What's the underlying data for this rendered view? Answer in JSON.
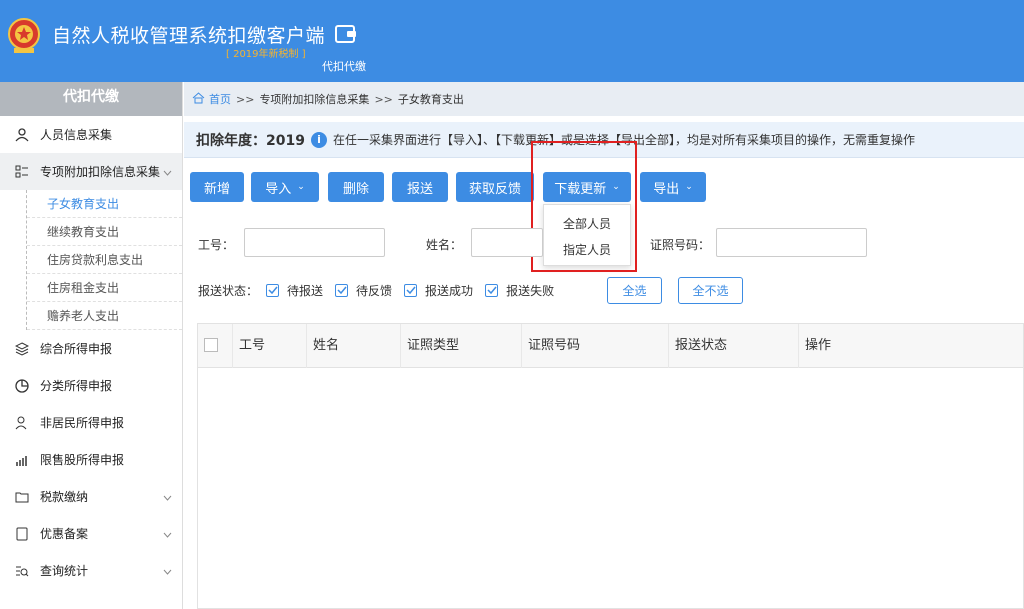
{
  "header": {
    "app_title": "自然人税收管理系统扣缴客户端",
    "version": "[ 2019年新税制 ]",
    "module_label": "代扣代缴"
  },
  "sidebar": {
    "title": "代扣代缴",
    "items": [
      {
        "label": "人员信息采集",
        "icon": "person-icon"
      },
      {
        "label": "专项附加扣除信息采集",
        "icon": "list-icon",
        "expanded": true,
        "children": [
          "子女教育支出",
          "继续教育支出",
          "住房贷款利息支出",
          "住房租金支出",
          "赡养老人支出"
        ]
      },
      {
        "label": "综合所得申报",
        "icon": "layers-icon"
      },
      {
        "label": "分类所得申报",
        "icon": "pie-icon"
      },
      {
        "label": "非居民所得申报",
        "icon": "user-outline-icon"
      },
      {
        "label": "限售股所得申报",
        "icon": "chart-icon"
      },
      {
        "label": "税款缴纳",
        "icon": "folder-icon"
      },
      {
        "label": "优惠备案",
        "icon": "document-icon"
      },
      {
        "label": "查询统计",
        "icon": "search-list-icon"
      }
    ]
  },
  "breadcrumb": {
    "home": "首页",
    "sep": ">>",
    "level1": "专项附加扣除信息采集",
    "level2": "子女教育支出"
  },
  "info_bar": {
    "year_label": "扣除年度：2019",
    "text": "在任一采集界面进行【导入】、【下载更新】或是选择【导出全部】，均是对所有采集项目的操作，无需重复操作"
  },
  "toolbar": {
    "add": "新增",
    "import": "导入",
    "delete": "删除",
    "submit": "报送",
    "feedback": "获取反馈",
    "download_update": "下载更新",
    "export": "导出"
  },
  "dropdown": {
    "options": [
      "全部人员",
      "指定人员"
    ]
  },
  "filters": {
    "employee_id_label": "工号：",
    "name_label": "姓名：",
    "id_number_label": "证照号码：",
    "employee_id_value": "",
    "name_value": "",
    "id_number_value": ""
  },
  "status_filter": {
    "label": "报送状态：",
    "options": [
      "待报送",
      "待反馈",
      "报送成功",
      "报送失败"
    ],
    "select_all": "全选",
    "select_none": "全不选"
  },
  "table": {
    "columns": [
      "工号",
      "姓名",
      "证照类型",
      "证照号码",
      "报送状态",
      "操作"
    ]
  },
  "colors": {
    "primary": "#3d8ce3",
    "highlight": "#e02020",
    "version": "#f4b331"
  }
}
